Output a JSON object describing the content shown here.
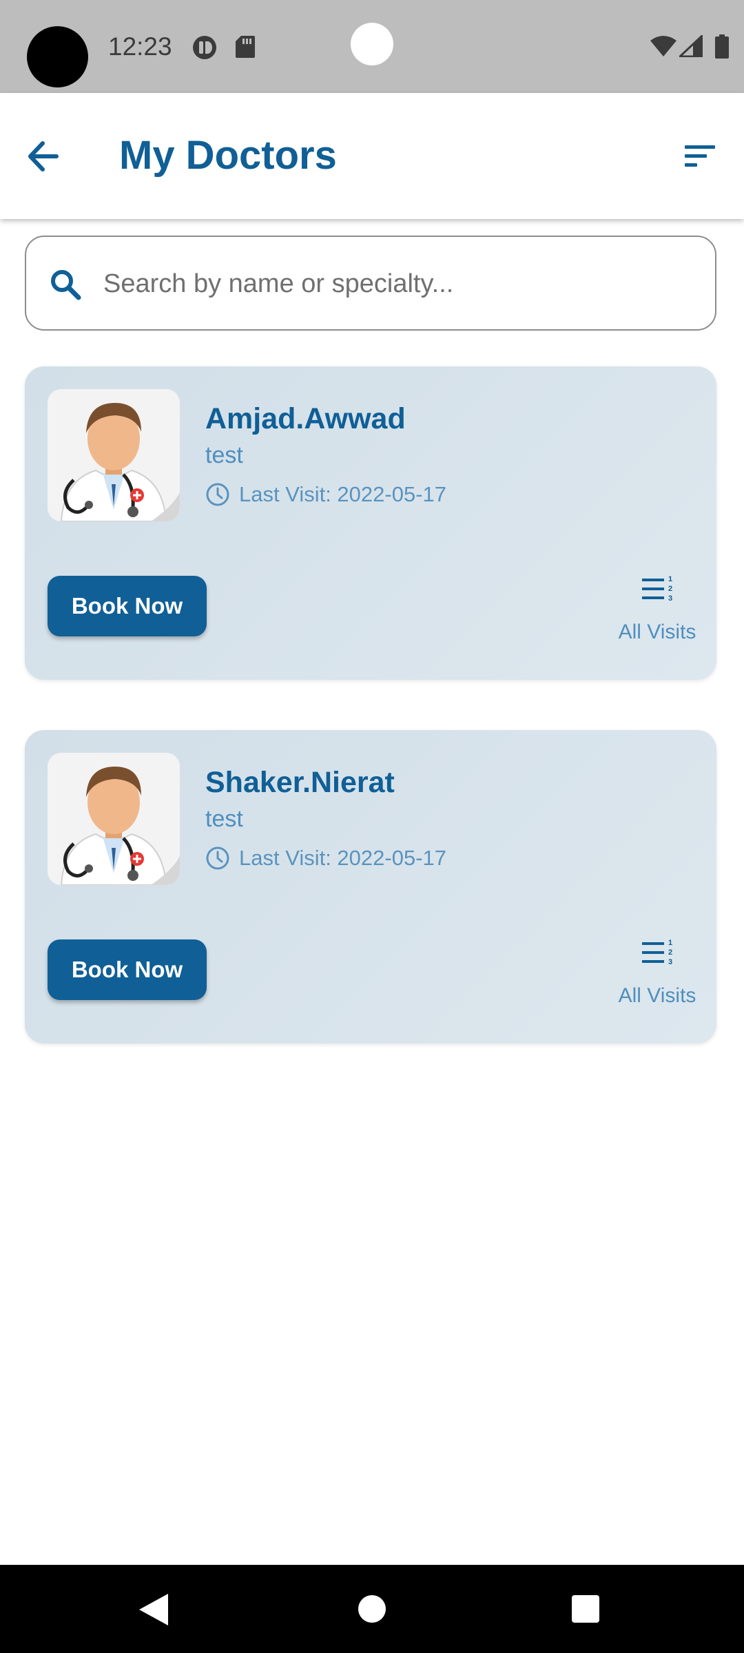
{
  "status_bar": {
    "time": "12:23",
    "icons": [
      "camera-hole",
      "notification-app-icon",
      "sd-card-icon",
      "wifi-icon",
      "signal-icon",
      "battery-icon"
    ]
  },
  "app_bar": {
    "title": "My Doctors",
    "back_icon": "arrow-left-icon",
    "filter_icon": "filter-list-icon"
  },
  "search": {
    "placeholder": "Search by name or specialty...",
    "value": "",
    "icon": "search-icon"
  },
  "doctors": [
    {
      "name": "Amjad.Awwad",
      "specialty": "test",
      "last_visit": "Last Visit: 2022-05-17",
      "book_label": "Book Now",
      "all_visits_label": "All Visits"
    },
    {
      "name": "Shaker.Nierat",
      "specialty": "test",
      "last_visit": "Last Visit: 2022-05-17",
      "book_label": "Book Now",
      "all_visits_label": "All Visits"
    }
  ],
  "colors": {
    "primary": "#105f96",
    "secondary_text": "#4f8fbe",
    "card_background": "#d6e2ea",
    "status_bar": "#bdbdbd",
    "nav_bar": "#000000"
  },
  "nav_bar": {
    "icons": [
      "nav-back-icon",
      "nav-home-icon",
      "nav-recents-icon"
    ]
  }
}
